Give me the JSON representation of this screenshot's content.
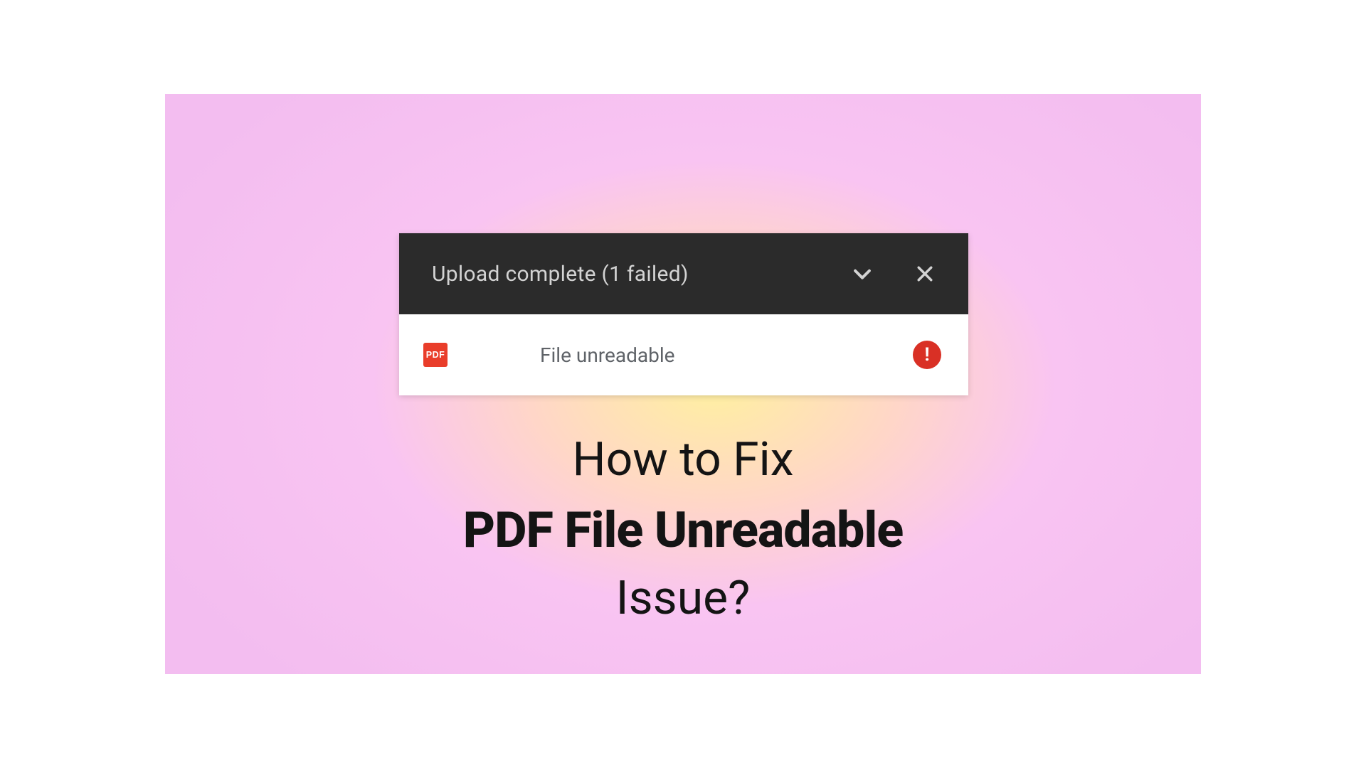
{
  "upload": {
    "header_text": "Upload complete (1 failed)",
    "file_type_label": "PDF",
    "file_status": "File unreadable",
    "error_symbol": "!"
  },
  "headline": {
    "line1": "How to Fix",
    "line2": "PDF File Unreadable",
    "line3": "Issue?"
  }
}
